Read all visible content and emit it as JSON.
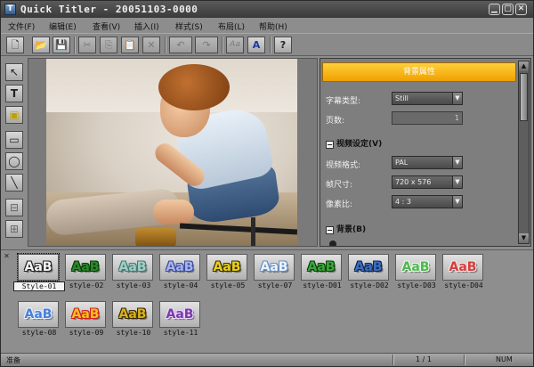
{
  "window": {
    "title": "Quick Titler - 20051103-0000",
    "app_icon_glyph": "T"
  },
  "title_buttons": [
    {
      "name": "minimize-button",
      "glyph": "▁"
    },
    {
      "name": "maximize-button",
      "glyph": "▢"
    },
    {
      "name": "close-button",
      "glyph": "✕"
    }
  ],
  "menu": [
    "文件(F)",
    "编辑(E)",
    "查看(V)",
    "插入(I)",
    "样式(S)",
    "布局(L)",
    "帮助(H)"
  ],
  "toolbar": [
    {
      "name": "new-icon",
      "glyph": "🗋",
      "disabled": false
    },
    {
      "name": "open-icon",
      "glyph": "📂",
      "disabled": false
    },
    {
      "name": "save-icon",
      "glyph": "💾",
      "disabled": false
    },
    {
      "name": "cut-icon",
      "glyph": "✂",
      "disabled": true
    },
    {
      "name": "copy-icon",
      "glyph": "⎘",
      "disabled": true
    },
    {
      "name": "paste-icon",
      "glyph": "📋",
      "disabled": true
    },
    {
      "name": "delete-icon",
      "glyph": "✕",
      "disabled": true
    },
    {
      "name": "undo-icon",
      "glyph": "↶",
      "disabled": true
    },
    {
      "name": "redo-icon",
      "glyph": "↷",
      "disabled": true
    },
    {
      "name": "text-style-icon",
      "glyph": "Aa",
      "disabled": true
    },
    {
      "name": "text-effect-icon",
      "glyph": "A",
      "disabled": false
    },
    {
      "name": "help-icon",
      "glyph": "?",
      "disabled": false
    }
  ],
  "tools": [
    {
      "name": "select-tool-icon",
      "glyph": "↖"
    },
    {
      "name": "text-tool-icon",
      "glyph": "T"
    },
    {
      "name": "image-tool-icon",
      "glyph": "▣"
    },
    {
      "name": "rectangle-tool-icon",
      "glyph": "▭"
    },
    {
      "name": "ellipse-tool-icon",
      "glyph": "◯"
    },
    {
      "name": "line-tool-icon",
      "glyph": "╲"
    },
    {
      "name": "align-tool-icon",
      "glyph": "⊟"
    },
    {
      "name": "layout-tool-icon",
      "glyph": "⊞"
    }
  ],
  "properties": {
    "header": "背景属性",
    "subtitle_type_label": "字幕类型:",
    "subtitle_type_value": "Still",
    "pages_label": "页数:",
    "pages_value": "1",
    "video_section": "视频设定(V)",
    "video_format_label": "视频格式:",
    "video_format_value": "PAL",
    "frame_size_label": "帧尺寸:",
    "frame_size_value": "720 x 576",
    "pixel_ratio_label": "像素比:",
    "pixel_ratio_value": "4 : 3",
    "background_section": "背景(B)"
  },
  "gallery": {
    "styles": [
      {
        "label": "Style-01",
        "text": "AaB",
        "color": "#f4f4f4",
        "stroke": "#222",
        "selected": true
      },
      {
        "label": "style-02",
        "text": "AaB",
        "color": "#2a8a2a",
        "stroke": "#0a3a0a",
        "selected": false
      },
      {
        "label": "style-03",
        "text": "AaB",
        "color": "#9fd0c8",
        "stroke": "#4a7a74",
        "selected": false
      },
      {
        "label": "style-04",
        "text": "AaB",
        "color": "#a8b4ec",
        "stroke": "#3c4c9c",
        "selected": false
      },
      {
        "label": "style-05",
        "text": "AaB",
        "color": "#e8d020",
        "stroke": "#3a3000",
        "selected": false
      },
      {
        "label": "style-07",
        "text": "AaB",
        "color": "#eef4fc",
        "stroke": "#6a90c0",
        "selected": false
      },
      {
        "label": "style-D01",
        "text": "AaB",
        "color": "#3aa83a",
        "stroke": "#0e3e0e",
        "selected": false
      },
      {
        "label": "style-D02",
        "text": "AaB",
        "color": "#3e6ec0",
        "stroke": "#0e2450",
        "selected": false
      },
      {
        "label": "style-D03",
        "text": "AaB",
        "color": "#50b850",
        "stroke": "#e8f8e8",
        "selected": false
      },
      {
        "label": "style-D04",
        "text": "AaB",
        "color": "#d04040",
        "stroke": "#f8e0e0",
        "selected": false
      },
      {
        "label": "style-08",
        "text": "AaB",
        "color": "#4a80d8",
        "stroke": "#e8f0fc",
        "selected": false
      },
      {
        "label": "style-09",
        "text": "AaB",
        "color": "#f4c020",
        "stroke": "#d02020",
        "selected": false
      },
      {
        "label": "style-10",
        "text": "AaB",
        "color": "#d8b020",
        "stroke": "#3a2a00",
        "selected": false
      },
      {
        "label": "style-11",
        "text": "AaB",
        "color": "#7a3aa8",
        "stroke": "#e8d8f8",
        "selected": false
      }
    ]
  },
  "status": {
    "text": "准备",
    "page": "1 / 1",
    "mode": "NUM"
  },
  "colors": {
    "accent": "#f0a000",
    "chrome": "#8d8d8d"
  }
}
